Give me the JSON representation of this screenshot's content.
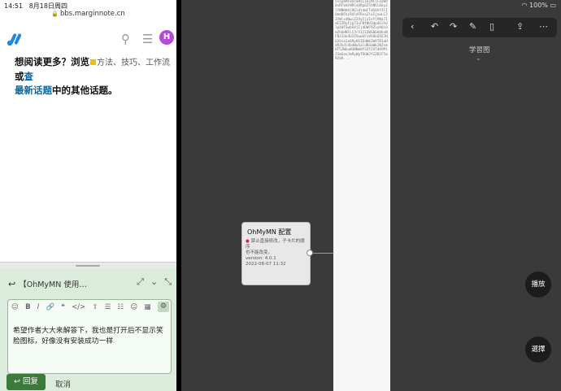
{
  "left_status": {
    "time": "14:51",
    "date": "8月18日周四"
  },
  "browser": {
    "url": "bbs.marginnote.cn"
  },
  "forum": {
    "logo_name": "marginnote-logo",
    "avatar_letter": "H",
    "promo_prefix": "想阅读更多？浏览",
    "promo_middle": "方法、技巧、工作流",
    "promo_or": "或",
    "promo_link1": "查",
    "promo_link2": "最新话题",
    "promo_suffix": "中的其他话题。"
  },
  "composer": {
    "title": "【OhMyMN 使用…",
    "body": "希望作者大大来解答下，我也是打开后不显示笑脸图标，好像没有安装成功一样",
    "reply_label": "回复",
    "cancel_label": "取消",
    "toolbar_glyphs": [
      "☺",
      "B",
      "I",
      "🔗",
      "❝",
      "</>",
      "⇧",
      "☰",
      "☷",
      "☺",
      "▦"
    ]
  },
  "right_status": {
    "battery": "100%"
  },
  "mindmap": {
    "label": "学習图",
    "node": {
      "title": "OhMyMN 配置",
      "line1": "禁止直接修改，子卡片的顺序",
      "line2": "也不能改变。",
      "version": "version: 4.0.1",
      "date": "2022-08-07 11:32"
    },
    "buttons": {
      "play": "播放",
      "select": "選擇"
    }
  },
  "doc_strip_text": "5n1pbMF0alm9sL1k1MTlFZyWd0sRFbmYWRlaXRpb25tNGl6eyJlYWNHdXlRGldldmFTdGVhY3lIOmd0FbiRdldFRva2luIjowLCJIYWlsdWwiZ2VyIjoInYlPNa7ImFZZRyIjp7IvFNtNU3dpdGlhdlpXdFSwbGVjIjdDWF9ZvyHQiOmZhbHNlLCJrY3JlZWSBbHdhxNFNiIdo4U2ZSwwGFsVGObG9ZJHU2Gsa1o6RyHSIEdWk2WXTB1aHdR3hdldb4Ww5aldRdaWk2WZsmHT5ZWbuW3NNmHY3ZYJVTdHYMlISmGeeJmRyWpTDUWJY2ZB1F5a9ZdO..."
}
